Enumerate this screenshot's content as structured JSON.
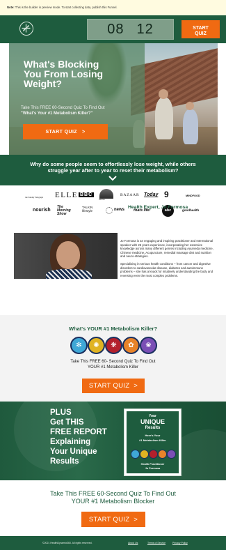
{
  "note": {
    "label": "Note:",
    "text": "This is the builder in preview mode. To start collecting data, publish this Funnel."
  },
  "header": {
    "timer_minutes": "08",
    "timer_seconds": "12",
    "start_label_line1": "START",
    "start_label_line2": "QUIZ",
    "accent_color": "#f06a12",
    "brand_color": "#1e5c3e"
  },
  "hero": {
    "title": "What's Blocking You From Losing Weight?",
    "subtitle": "Take This FREE 60-Second Quiz To Find Out",
    "subtitle_strong": "\"What's Your #1 Metabolism Killer?\"",
    "button_label": "START QUIZ",
    "button_arrow": ">"
  },
  "question_band": {
    "text": "Why do some people seem to effortlessly lose weight, while others struggle year after to year to reset their metabolism?",
    "icon": "chevron-down-icon"
  },
  "press_logos": [
    "the Sunday Telegraph",
    "ELLE",
    "BBC",
    "Sunrise",
    "BAZAAR",
    "Today",
    "9",
    "MINDFOOD",
    "nourish",
    "The Morning Show",
    "TALKIN lifestyle",
    "news",
    "thats life!",
    "abc",
    "goodhealth"
  ],
  "expert": {
    "title": "Health Expert, Jo Formosa",
    "para1": "Jo Formosa is an engaging and inspiring practitioner and International speaker with 25 years experience, incorporating her extensive knowledge across many different genres including Ayurveda medicine, Chinese medicine, Acupuncture, remedial massage diet and nutrition and neuro-strategies.",
    "para2": "Specialising in serious health conditions – from cancer and digestive disorders to cardiovascular disease, diabetes and autoimmune problems – she has a knack for intuitively understanding the body and reversing even the most complex problems."
  },
  "quiz": {
    "title": "What's YOUR #1 Metabolism Killer?",
    "subtitle_line1": "Take This FREE 60- Second Quiz To Find Out",
    "subtitle_line2": "YOUR #1 Metabolism Killer",
    "button_label": "START QUIZ",
    "button_arrow": ">",
    "circle_colors": [
      "#3fa7d6",
      "#e0b322",
      "#b3202c",
      "#e7832a",
      "#7a4fb5"
    ],
    "circle_icons": [
      "droplet-icon",
      "sun-icon",
      "flame-icon",
      "leaf-icon",
      "lotus-icon"
    ]
  },
  "plus": {
    "line1": "PLUS",
    "line2": "Get THIS",
    "line3": "FREE REPORT",
    "line4": "Explaining",
    "line5": "Your Unique",
    "line6": "Results",
    "report_your": "Your",
    "report_unique": "UNIQUE",
    "report_results": "Results",
    "report_heres": "Here's Your",
    "report_killer": "#1 Metabolism Killer",
    "report_by1": "Health Practitioner",
    "report_by2": "Jo Formosa"
  },
  "cta2": {
    "line1": "Take This FREE 60-Second Quiz To Find Out",
    "line2": "YOUR #1 Metabolism Blocker",
    "button_label": "START QUIZ",
    "button_arrow": ">"
  },
  "footer": {
    "copyright": "©2021 HealthDynamix360. All rights reserved.",
    "about": "About Us",
    "terms": "Terms of Service",
    "privacy": "Privacy Policy"
  }
}
